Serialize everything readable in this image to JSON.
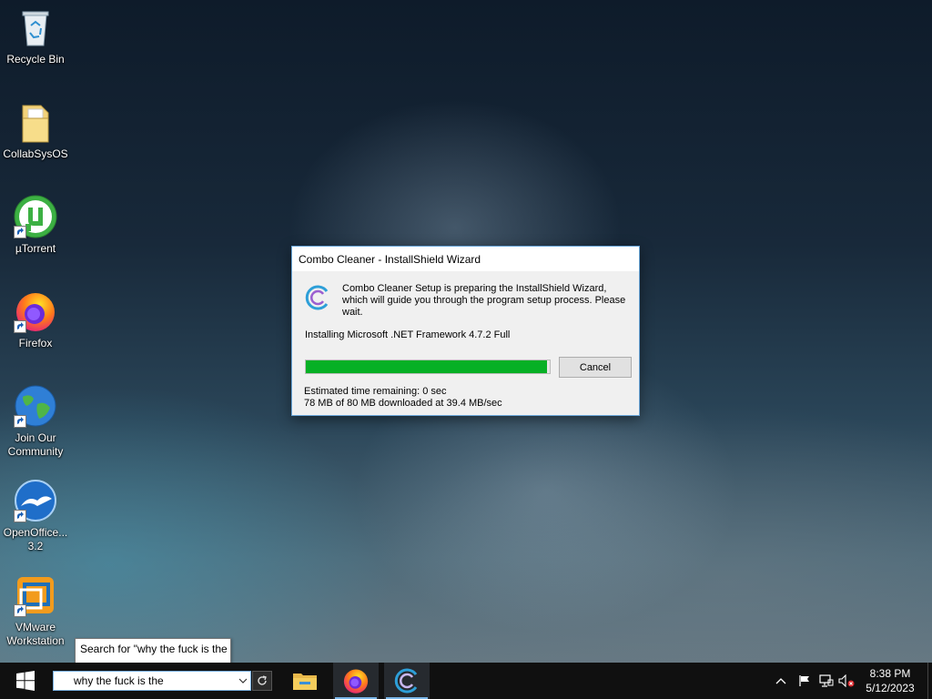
{
  "desktop": {
    "icons": [
      {
        "label": "Recycle Bin",
        "icon": "recycle-bin-icon"
      },
      {
        "label": "CollabSysOS",
        "icon": "folder-icon"
      },
      {
        "label": "µTorrent",
        "icon": "utorrent-icon"
      },
      {
        "label": "Firefox",
        "icon": "firefox-icon"
      },
      {
        "label": "Join Our Community",
        "icon": "globe-icon"
      },
      {
        "label": "OpenOffice... 3.2",
        "icon": "openoffice-icon"
      },
      {
        "label": "VMware Workstation",
        "icon": "vmware-icon"
      }
    ]
  },
  "dialog": {
    "title": "Combo Cleaner - InstallShield Wizard",
    "message": "Combo Cleaner Setup is preparing the InstallShield Wizard, which will guide you through the program setup process.  Please wait.",
    "status": "Installing Microsoft .NET Framework 4.7.2 Full",
    "progress": 0.99,
    "cancel_label": "Cancel",
    "time_remaining": "Estimated time remaining:  0 sec",
    "download_info": "78 MB of 80 MB downloaded at 39.4 MB/sec",
    "colors": {
      "progress_fill": "#06b025",
      "logo": "#3aa6d9"
    }
  },
  "search": {
    "tooltip": "Search for \"why the fuck is the",
    "value": "why the fuck is the"
  },
  "taskbar": {
    "apps": [
      "file-explorer-icon",
      "firefox-icon",
      "combo-cleaner-icon"
    ],
    "tray_icons": [
      "chevron-up-icon",
      "flag-icon",
      "network-icon",
      "volume-muted-icon"
    ],
    "time": "8:38 PM",
    "date": "5/12/2023"
  }
}
